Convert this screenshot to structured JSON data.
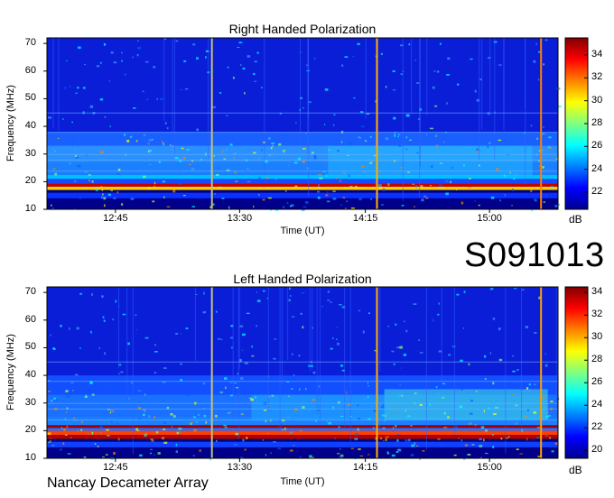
{
  "chart_data": [
    {
      "type": "heatmap",
      "title": "Right Handed Polarization",
      "xlabel": "Time (UT)",
      "ylabel": "Frequency (MHz)",
      "x_ticks": [
        "12:45",
        "13:30",
        "14:15",
        "15:00"
      ],
      "y_ticks": [
        10,
        20,
        30,
        40,
        50,
        60,
        70
      ],
      "ylim": [
        10,
        72
      ],
      "colorbar": {
        "label": "dB",
        "ticks": [
          22,
          24,
          26,
          28,
          30,
          32,
          34
        ],
        "range": [
          20.5,
          35.5
        ]
      },
      "colorscale": [
        "#00008f",
        "#0000ff",
        "#0080ff",
        "#00ffff",
        "#80ff80",
        "#ffff00",
        "#ff8000",
        "#ff0000",
        "#800000"
      ]
    },
    {
      "type": "heatmap",
      "title": "Left Handed Polarization",
      "xlabel": "Time (UT)",
      "ylabel": "Frequency (MHz)",
      "x_ticks": [
        "12:45",
        "13:30",
        "14:15",
        "15:00"
      ],
      "y_ticks": [
        10,
        20,
        30,
        40,
        50,
        60,
        70
      ],
      "ylim": [
        10,
        72
      ],
      "colorbar": {
        "label": "dB",
        "ticks": [
          20,
          22,
          24,
          26,
          28,
          30,
          32,
          34
        ],
        "range": [
          19.3,
          34.5
        ]
      },
      "colorscale": [
        "#00008f",
        "#0000ff",
        "#0080ff",
        "#00ffff",
        "#80ff80",
        "#ffff00",
        "#ff8000",
        "#ff0000",
        "#800000"
      ]
    }
  ],
  "observation_id": "S091013",
  "footer": "Nancay Decameter Array"
}
